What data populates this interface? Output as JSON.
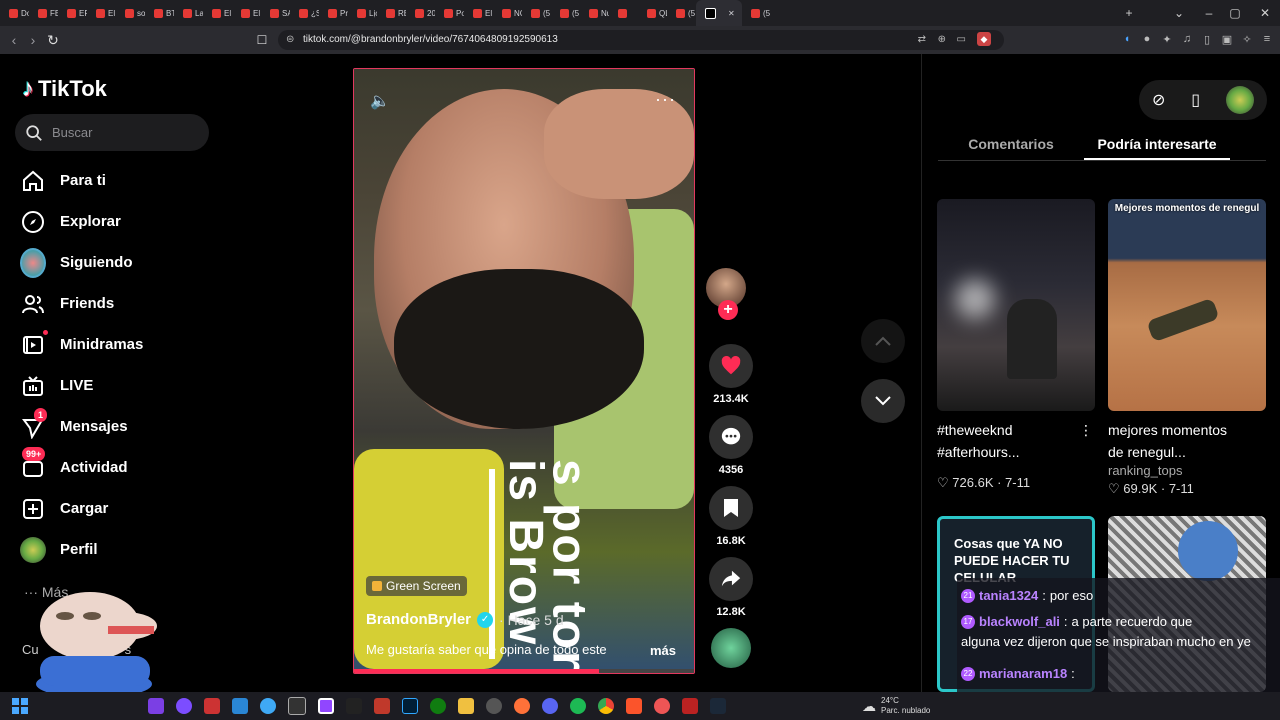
{
  "browser": {
    "tabs": [
      "Do",
      "FE",
      "EP",
      "El",
      "sor",
      "BT",
      "La",
      "El",
      "El",
      "SA",
      "¿S",
      "Pro",
      "Lịc",
      "RE",
      "20",
      "Po",
      "El",
      "NC",
      "(5",
      "(5",
      "Nu",
      "",
      "QL",
      "(5",
      "",
      "(5"
    ],
    "active_tab_close": "✕",
    "new_tab": "+",
    "url": "tiktok.com/@brandonbryler/video/7674064809192590613"
  },
  "sidebar": {
    "logo": "TikTok",
    "search_placeholder": "Buscar",
    "items": [
      {
        "label": "Para ti",
        "icon": "home-icon"
      },
      {
        "label": "Explorar",
        "icon": "compass-icon"
      },
      {
        "label": "Siguiendo",
        "icon": "following-avatar"
      },
      {
        "label": "Friends",
        "icon": "friends-icon"
      },
      {
        "label": "Minidramas",
        "icon": "film-icon"
      },
      {
        "label": "LIVE",
        "icon": "live-tv-icon"
      },
      {
        "label": "Mensajes",
        "icon": "send-icon",
        "badge": "1"
      },
      {
        "label": "Actividad",
        "icon": "activity-icon",
        "badge": "99+"
      },
      {
        "label": "Cargar",
        "icon": "upload-icon"
      },
      {
        "label": "Perfil",
        "icon": "profile-avatar"
      }
    ],
    "more": "Más",
    "accounts_label": "Cu",
    "accounts_suffix": "s"
  },
  "video": {
    "overlay_text": "s por tor is Brow",
    "tag": "Green Screen",
    "author": "BrandonBryler",
    "posted": "· Hace 5 d",
    "description": "Me gustaría saber qué opina de todo este",
    "more": "más",
    "progress": 0.72
  },
  "actions": {
    "likes": "213.4K",
    "comments": "4356",
    "saves": "16.8K",
    "shares": "12.8K"
  },
  "right_panel": {
    "tabs": [
      "Comentarios",
      "Podría interesarte"
    ],
    "active_tab": "Podría interesarte",
    "cards": [
      {
        "title_line1": "#theweeknd",
        "title_line2": "#afterhours...",
        "user": "",
        "likes": "726.6K",
        "date": "7-11"
      },
      {
        "overlay": "Mejores momentos de renegul",
        "title_line1": "mejores momentos",
        "title_line2": "de renegul...",
        "user": "ranking_tops",
        "likes": "69.9K",
        "date": "7-11"
      },
      {
        "overlay": "Cosas que YA NO PUEDE HACER TU CELULAR"
      },
      {
        "overlay": ""
      }
    ]
  },
  "chat": {
    "lines": [
      {
        "badge": "21",
        "user": "tania1324",
        "text": "por eso"
      },
      {
        "badge": "17",
        "user": "blackwolf_ali",
        "text": "a parte recuerdo que"
      },
      {
        "badge": "",
        "user": "",
        "text": "alguna vez dijeron que se inspiraban mucho en ye"
      },
      {
        "badge": "22",
        "user": "marianaram18",
        "text": ""
      },
      {
        "badge": "23",
        "user": "",
        "text": ""
      }
    ]
  },
  "taskbar": {
    "temp": "24°C",
    "weather": "Parc. nublado"
  },
  "colors": {
    "accent": "#fe2c55",
    "teal": "#25f4ee",
    "verified": "#20d5ec"
  }
}
